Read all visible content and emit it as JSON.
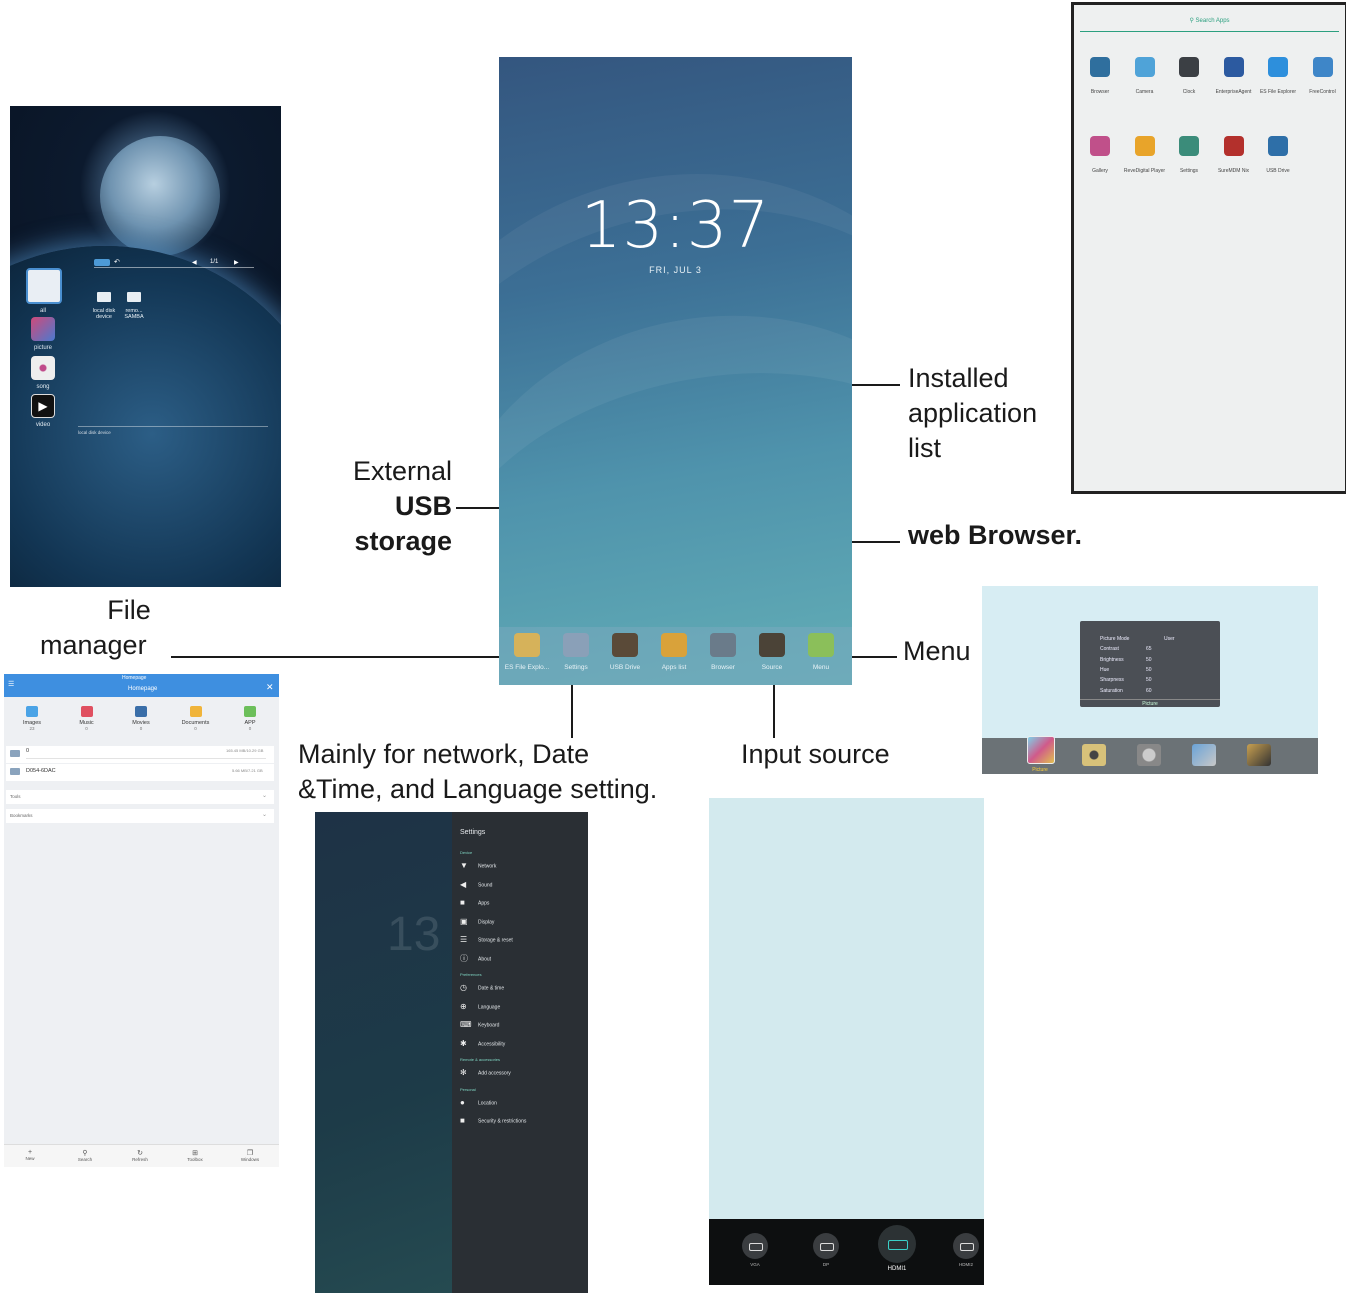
{
  "annotations": {
    "file_manager": [
      "File",
      "manager"
    ],
    "usb_storage": [
      "External",
      "USB",
      "storage"
    ],
    "apps_list": [
      "Installed",
      "application",
      "list"
    ],
    "web_browser": "web Browser.",
    "menu": "Menu",
    "settings": [
      "Mainly for network, Date",
      "&Time, and Language setting."
    ],
    "input_source": "Input source"
  },
  "home": {
    "time": "13:37",
    "date": "FRI, JUL 3",
    "dock": [
      {
        "label": "ES File Explo...",
        "icon": "es-file-explorer-icon",
        "color": "#d6b25a"
      },
      {
        "label": "Settings",
        "icon": "settings-tools-icon",
        "color": "#8aa0b8"
      },
      {
        "label": "USB Drive",
        "icon": "usb-drive-icon",
        "color": "#5a4a38"
      },
      {
        "label": "Apps list",
        "icon": "apps-list-icon",
        "color": "#d9a23a"
      },
      {
        "label": "Browser",
        "icon": "browser-globe-icon",
        "color": "#6a7b8a"
      },
      {
        "label": "Source",
        "icon": "source-plug-icon",
        "color": "#4b4337"
      },
      {
        "label": "Menu",
        "icon": "menu-stack-icon",
        "color": "#8bbf5a"
      }
    ]
  },
  "space_browser": {
    "pager": "1/1",
    "sidebar": [
      "all",
      "picture",
      "song",
      "video"
    ],
    "folders": [
      {
        "line1": "local disk",
        "line2": "device"
      },
      {
        "line1": "remo...",
        "line2": "SAMBA"
      }
    ],
    "footer": "local disk device"
  },
  "apps_list": {
    "search_placeholder": "Search Apps",
    "apps": [
      {
        "name": "Browser",
        "color": "#2f6f9e"
      },
      {
        "name": "Camera",
        "color": "#4fa3d8"
      },
      {
        "name": "Clock",
        "color": "#3b3f44"
      },
      {
        "name": "EnterpriseAgent",
        "color": "#2c5aa0"
      },
      {
        "name": "ES File Explorer",
        "color": "#2d8fdc"
      },
      {
        "name": "FreeControl",
        "color": "#3e86c8"
      },
      {
        "name": "Gallery",
        "color": "#c0508a"
      },
      {
        "name": "ReveDigital Player",
        "color": "#e8a42a"
      },
      {
        "name": "Settings",
        "color": "#3b8c7a"
      },
      {
        "name": "SureMDM Nix",
        "color": "#b3302c"
      },
      {
        "name": "USB Drive",
        "color": "#2e6fa8"
      }
    ]
  },
  "picture_menu": {
    "rows": [
      {
        "label": "Picture Mode",
        "value": "User"
      },
      {
        "label": "Contrast",
        "value": "65"
      },
      {
        "label": "Brightness",
        "value": "50"
      },
      {
        "label": "Hue",
        "value": "50"
      },
      {
        "label": "Sharpness",
        "value": "50"
      },
      {
        "label": "Saturation",
        "value": "60"
      }
    ],
    "panel_title": "Picture",
    "bottom_label": "Picture"
  },
  "file_manager": {
    "title": "Homepage",
    "subtitle": "Homepage",
    "categories": [
      {
        "name": "Images",
        "count": "23",
        "color": "#4aa3e6"
      },
      {
        "name": "Music",
        "count": "0",
        "color": "#e05060"
      },
      {
        "name": "Movies",
        "count": "0",
        "color": "#3a6ea8"
      },
      {
        "name": "Documents",
        "count": "0",
        "color": "#f0b43a"
      },
      {
        "name": "APP",
        "count": "0",
        "color": "#6cbf5a"
      }
    ],
    "storage": [
      {
        "name": "0",
        "info": "165.45 MB/10.29 GB"
      },
      {
        "name": "D054-6DAC",
        "info": "5.66 MB/7.21 GB"
      }
    ],
    "sections": [
      "Tools",
      "Bookmarks"
    ],
    "bottom": [
      "New",
      "Search",
      "Refresh",
      "Toolbox",
      "Windows"
    ]
  },
  "settings": {
    "ghost_time": "13",
    "title": "Settings",
    "sections": [
      {
        "header": "Device",
        "items": [
          "Network",
          "Sound",
          "Apps",
          "Display",
          "Storage & reset",
          "About"
        ]
      },
      {
        "header": "Preferences",
        "items": [
          "Date & time",
          "Language",
          "Keyboard",
          "Accessibility"
        ]
      },
      {
        "header": "Remote & accessories",
        "items": [
          "Add accessory"
        ]
      },
      {
        "header": "Personal",
        "items": [
          "Location",
          "Security & restrictions"
        ]
      }
    ]
  },
  "input_source": {
    "sources": [
      "VGA",
      "DP",
      "HDMI1",
      "HDMI2"
    ],
    "selected": "HDMI1"
  }
}
